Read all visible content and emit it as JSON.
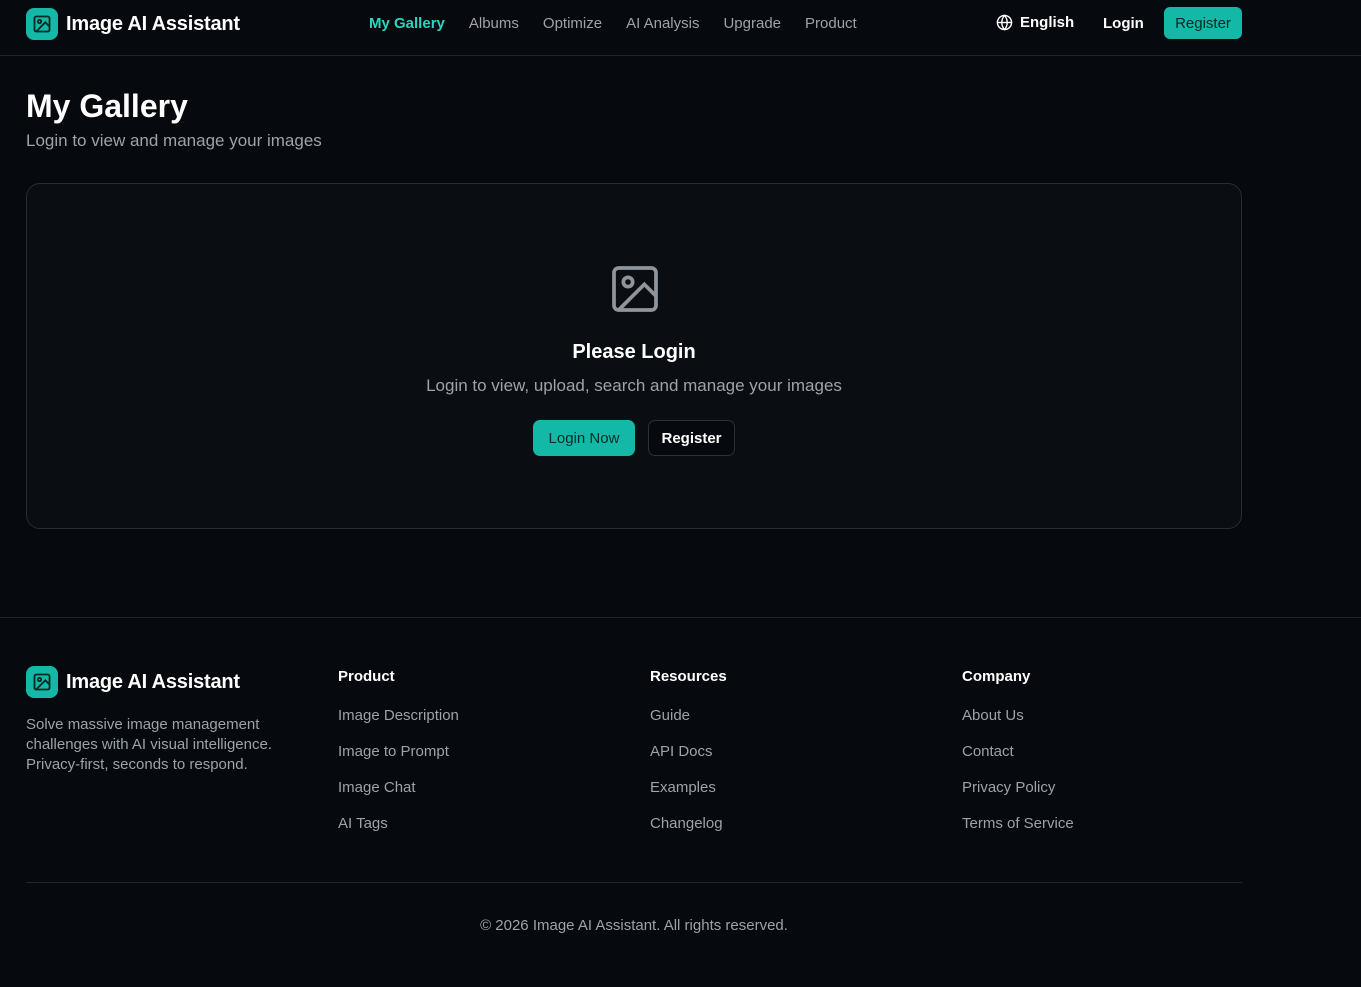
{
  "header": {
    "brand": "Image AI Assistant",
    "nav": [
      "My Gallery",
      "Albums",
      "Optimize",
      "AI Analysis",
      "Upgrade",
      "Product"
    ],
    "language": "English",
    "login": "Login",
    "register": "Register"
  },
  "main": {
    "title": "My Gallery",
    "subtitle": "Login to view and manage your images",
    "card": {
      "title": "Please Login",
      "text": "Login to view, upload, search and manage your images",
      "login_button": "Login Now",
      "register_button": "Register"
    }
  },
  "footer": {
    "brand": "Image AI Assistant",
    "description": "Solve massive image management challenges with AI visual intelligence. Privacy-first, seconds to respond.",
    "columns": [
      {
        "title": "Product",
        "links": [
          "Image Description",
          "Image to Prompt",
          "Image Chat",
          "AI Tags"
        ]
      },
      {
        "title": "Resources",
        "links": [
          "Guide",
          "API Docs",
          "Examples",
          "Changelog"
        ]
      },
      {
        "title": "Company",
        "links": [
          "About Us",
          "Contact",
          "Privacy Policy",
          "Terms of Service"
        ]
      }
    ],
    "copyright": "© 2026 Image AI Assistant. All rights reserved."
  },
  "colors": {
    "accent": "#14b8a6",
    "accent_text": "#2dd4bf",
    "background": "#06090d"
  },
  "icons": [
    "image-logo-icon",
    "globe-icon",
    "image-placeholder-icon"
  ]
}
